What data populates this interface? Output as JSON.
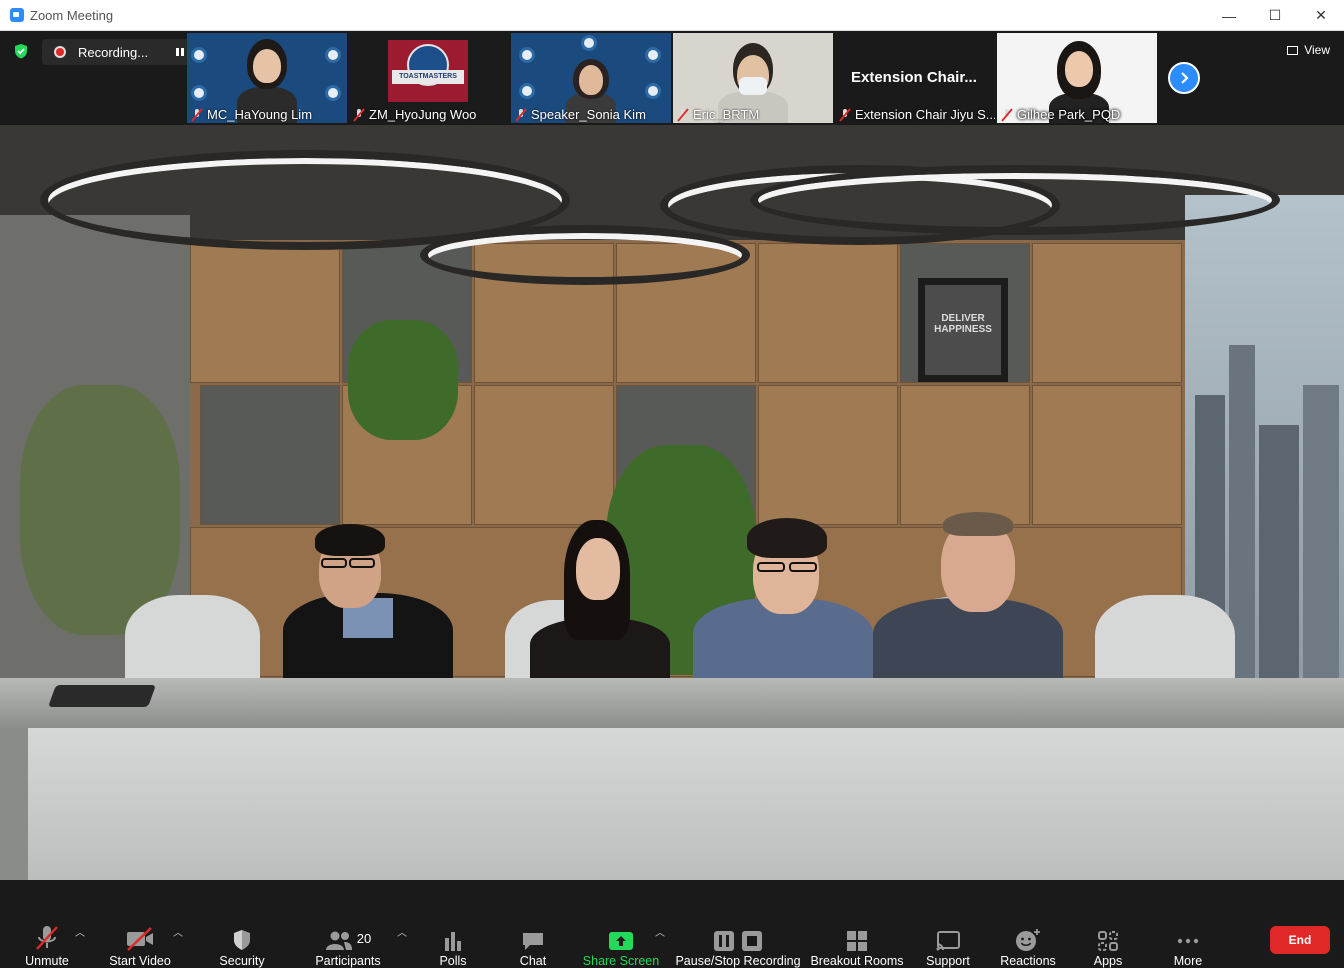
{
  "window": {
    "title": "Zoom Meeting",
    "minimize": "—",
    "maximize": "☐",
    "close": "✕"
  },
  "recording": {
    "status": "Recording..."
  },
  "participants_strip": [
    {
      "name": "MC_HaYoung Lim"
    },
    {
      "name": "ZM_HyoJung Woo",
      "logo_text": "TOASTMASTERS"
    },
    {
      "name": "Speaker_Sonia Kim"
    },
    {
      "name": "Eric_BRTM"
    },
    {
      "name": "Extension Chair Jiyu S...",
      "display_title": "Extension  Chair..."
    },
    {
      "name": "Gilhee Park_PQD"
    }
  ],
  "view_button": {
    "label": "View"
  },
  "main_video": {
    "frame_text": "DELIVER HAPPINESS"
  },
  "toolbar": {
    "unmute": "Unmute",
    "start_video": "Start Video",
    "security": "Security",
    "participants": "Participants",
    "participants_count": "20",
    "polls": "Polls",
    "chat": "Chat",
    "share_screen": "Share Screen",
    "pause_stop_recording": "Pause/Stop Recording",
    "breakout_rooms": "Breakout Rooms",
    "support": "Support",
    "reactions": "Reactions",
    "apps": "Apps",
    "more": "More",
    "end": "End"
  },
  "colors": {
    "accent_blue": "#2d8cff",
    "share_green": "#23d959",
    "end_red": "#e02828",
    "mute_red": "#e02828",
    "toolbar_bg": "#1a1a1a"
  }
}
